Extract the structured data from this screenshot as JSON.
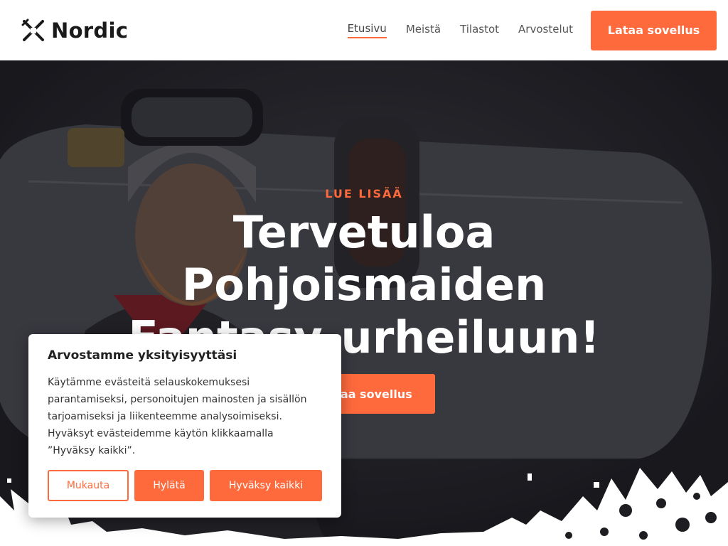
{
  "header": {
    "brand": "Nordic",
    "nav": [
      "Etusivu",
      "Meistä",
      "Tilastot",
      "Arvostelut"
    ],
    "cta": "Lataa sovellus"
  },
  "hero": {
    "kicker": "LUE LISÄÄ",
    "headline_lines": [
      "Tervetuloa",
      "Pohjoismaiden",
      "Fantasy-urheiluun!"
    ],
    "cta": "Lataa sovellus"
  },
  "cookie": {
    "title": "Arvostamme yksityisyyttäsi",
    "text": "Käytämme evästeitä selauskokemuksesi parantamiseksi, personoitujen mainosten ja sisällön tarjoamiseksi ja liikenteemme analysoimiseksi. Hyväksyt evästeidemme käytön klikkaamalla ”Hyväksy kaikki”.",
    "customize": "Mukauta",
    "reject": "Hylätä",
    "accept": "Hyväksy kaikki"
  },
  "colors": {
    "accent": "#ff6a3d",
    "header_bg": "#ffffff",
    "hero_bg": "#1e1e22"
  },
  "icons": {
    "logo": "crossed-skis-icon"
  }
}
